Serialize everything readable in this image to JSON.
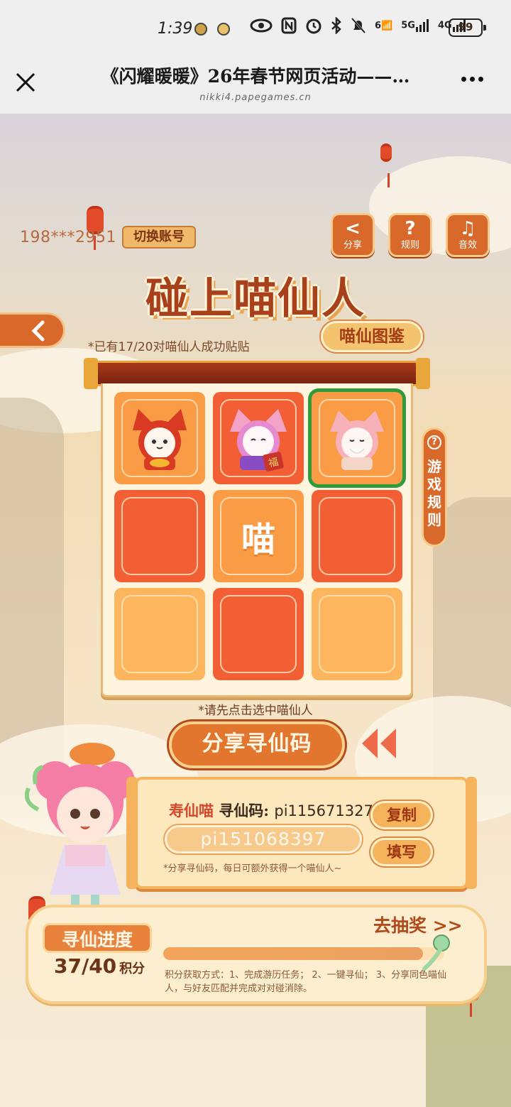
{
  "status_bar": {
    "time": "1:39",
    "network_1": "6",
    "network_2": "5G",
    "network_3": "4G",
    "battery": "99"
  },
  "browser": {
    "title": "《闪耀暖暖》26年春节网页活动——…",
    "url": "nikki4.papegames.cn"
  },
  "account": {
    "phone": "198***2951",
    "switch_label": "切换账号"
  },
  "top_buttons": [
    {
      "icon": "share-icon",
      "glyph": "<",
      "label": "分享"
    },
    {
      "icon": "question-icon",
      "glyph": "?",
      "label": "规则"
    },
    {
      "icon": "music-icon",
      "glyph": "♫",
      "label": "音效"
    }
  ],
  "title": "碰上喵仙人",
  "progress_note": "*已有17/20对喵仙人成功贴贴",
  "guide_button": "喵仙图鉴",
  "board": {
    "center_text": "喵",
    "fu_text": "福",
    "tiles": [
      {
        "kind": "cat-red",
        "color": "orange",
        "selected": false
      },
      {
        "kind": "cat-pink-fu",
        "color": "red",
        "selected": false
      },
      {
        "kind": "cat-pink-old",
        "color": "orange",
        "selected": true
      },
      {
        "kind": "empty",
        "color": "red",
        "selected": false
      },
      {
        "kind": "miao",
        "color": "orange",
        "selected": false
      },
      {
        "kind": "empty",
        "color": "red",
        "selected": false
      },
      {
        "kind": "empty",
        "color": "light",
        "selected": false
      },
      {
        "kind": "empty",
        "color": "red",
        "selected": false
      },
      {
        "kind": "empty",
        "color": "light",
        "selected": false
      }
    ]
  },
  "side_rules": {
    "q": "?",
    "label": "游戏规则"
  },
  "select_note": "*请先点击选中喵仙人",
  "share_code_button": "分享寻仙码",
  "code_panel": {
    "name": "寿仙喵",
    "tag": "寻仙码:",
    "my_code": "pi115671327",
    "input_value": "pi151068397",
    "copy_label": "复制",
    "fill_label": "填写",
    "hint": "*分享寻仙码，每日可额外获得一个喵仙人~"
  },
  "progress": {
    "title": "寻仙进度",
    "current": "37",
    "max": "40",
    "unit": "积分",
    "fraction": 0.925,
    "draw_link": "去抽奖 >>",
    "description": "积分获取方式：1、完成游历任务；  2、一键寻仙；  3、分享同色喵仙人，与好友匹配并完成对对碰消除。"
  },
  "colors": {
    "accent_orange": "#d9682b",
    "title_red": "#a8401b",
    "tile_orange": "#fa9b45",
    "tile_red": "#f35f34",
    "tile_light": "#fdb65d",
    "selected_green": "#2f9a3e"
  }
}
